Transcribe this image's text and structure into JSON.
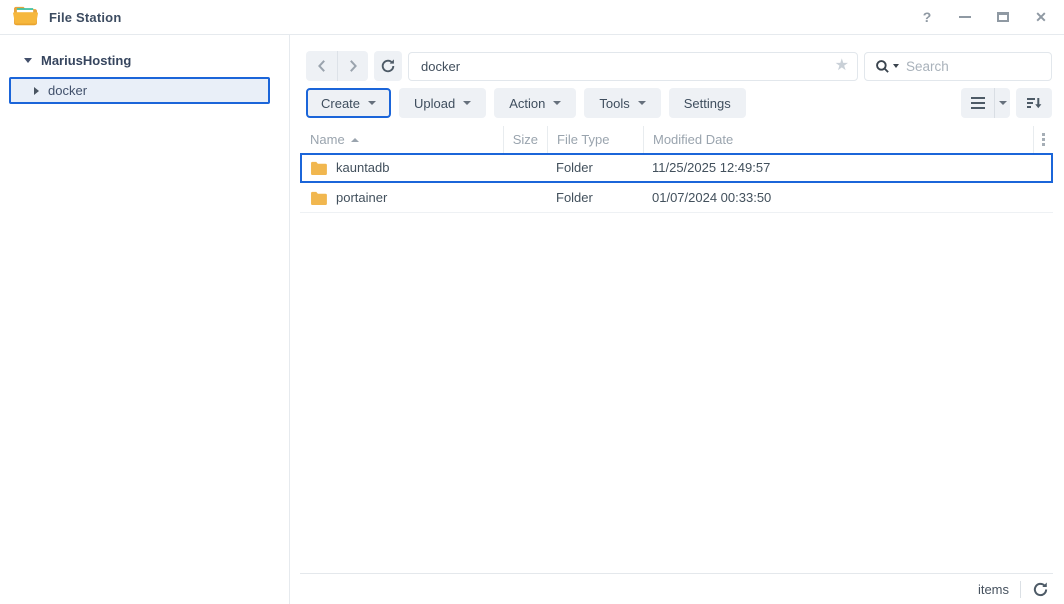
{
  "window": {
    "title": "File Station",
    "help_label": "?"
  },
  "sidebar": {
    "root_label": "MariusHosting",
    "items": [
      {
        "label": "docker",
        "selected": true
      }
    ]
  },
  "toolbar": {
    "path_value": "docker",
    "search_placeholder": "Search",
    "buttons": [
      {
        "label": "Create",
        "caret": true,
        "highlighted": true
      },
      {
        "label": "Upload",
        "caret": true,
        "highlighted": false
      },
      {
        "label": "Action",
        "caret": true,
        "highlighted": false
      },
      {
        "label": "Tools",
        "caret": true,
        "highlighted": false
      },
      {
        "label": "Settings",
        "caret": false,
        "highlighted": false
      }
    ]
  },
  "table": {
    "columns": [
      "Name",
      "Size",
      "File Type",
      "Modified Date"
    ],
    "sort": {
      "column": "Name",
      "direction": "ascending"
    },
    "rows": [
      {
        "name": "kauntadb",
        "size": "",
        "file_type": "Folder",
        "modified_date": "11/25/2025 12:49:57",
        "selected": true
      },
      {
        "name": "portainer",
        "size": "",
        "file_type": "Folder",
        "modified_date": "01/07/2024 00:33:50",
        "selected": false
      }
    ]
  },
  "statusbar": {
    "items_label": "items"
  },
  "colors": {
    "accent": "#1b65d9",
    "folder_icon": "#f1b74f",
    "app_folder_front": "#f6b73c",
    "app_folder_back": "#e8a33d"
  }
}
